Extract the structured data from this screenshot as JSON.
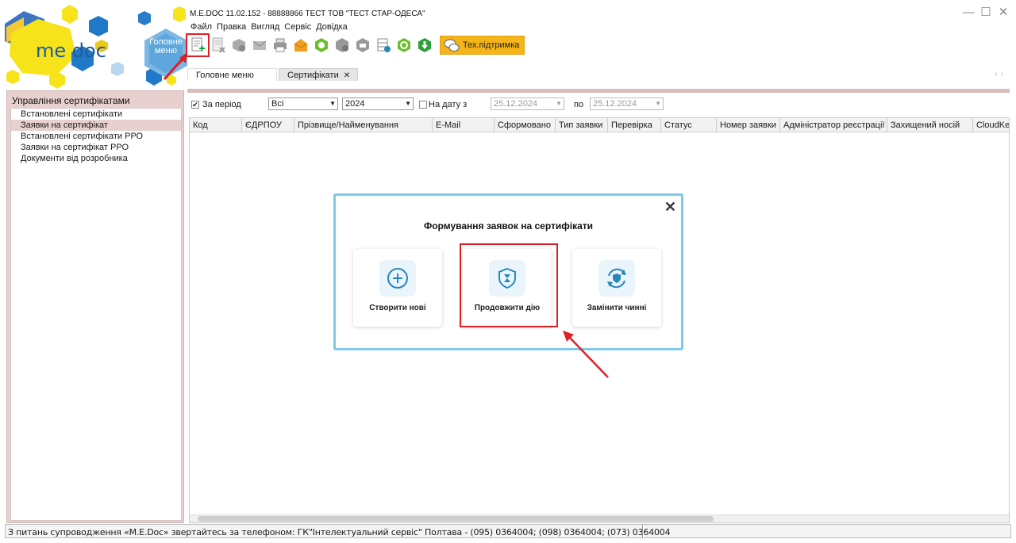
{
  "logo": {
    "text": "me doc"
  },
  "main_menu": {
    "label": "Головне меню"
  },
  "titlebar": {
    "title": "M.E.DOC 11.02.152  - 88888866 ТЕСТ ТОВ \"ТЕСТ СТАР-ОДЕСА\""
  },
  "menubar": {
    "items": [
      "Файл",
      "Правка",
      "Вигляд",
      "Сервіс",
      "Довідка"
    ]
  },
  "toolbar": {
    "icons": [
      "new-document-icon",
      "delete-document-icon",
      "sign-icon",
      "send-icon",
      "print-icon",
      "open-envelope-icon",
      "green-hex-icon",
      "gear-hex-icon",
      "archive-icon",
      "table-settings-icon",
      "refresh-icon",
      "download-icon"
    ],
    "support_label": "Тех.підтримка"
  },
  "tabs": [
    {
      "label": "Головне меню"
    },
    {
      "label": "Сертифікати"
    }
  ],
  "left_panel": {
    "title": "Управління сертифікатами",
    "items": [
      "Встановлені сертифікати",
      "Заявки на сертифікат",
      "Встановлені сертифікати РРО",
      "Заявки на сертифікат РРО",
      "Документи від розробника"
    ],
    "active_index": 1
  },
  "filters": {
    "period_label": "За період",
    "period_checked": true,
    "period_value": "Всі",
    "year_value": "2024",
    "on_date_label": "На дату з",
    "on_date_checked": false,
    "date_from": "25.12.2024",
    "to_label": "по",
    "date_to": "25.12.2024"
  },
  "table": {
    "columns": [
      "Код",
      "ЄДРПОУ",
      "Прізвище/Найменування",
      "E-Mail",
      "Сформовано",
      "Тип заявки",
      "Перевірка",
      "Статус",
      "Номер заявки",
      "Адміністратор реєстрації",
      "Захищений носій",
      "CloudKey"
    ]
  },
  "modal": {
    "title": "Формування заявок на сертифікати",
    "cards": [
      {
        "label": "Створити нові",
        "icon": "plus-circle-icon"
      },
      {
        "label": "Продовжити дію",
        "icon": "shield-hourglass-icon"
      },
      {
        "label": "Замінити чинні",
        "icon": "shield-refresh-icon"
      }
    ]
  },
  "statusbar": {
    "text": "З питань супроводження «M.E.Doc» звертайтесь за телефоном: ГК\"Інтелектуальний сервіс\" Полтава - (095) 0364004;  (098) 0364004;  (073) 0364004"
  },
  "colors": {
    "accent": "#f4b41a",
    "highlight": "#e01f24",
    "panel": "#e8d0cf",
    "modal_border": "#7ec8ea",
    "icon_blue": "#2a86b8"
  }
}
